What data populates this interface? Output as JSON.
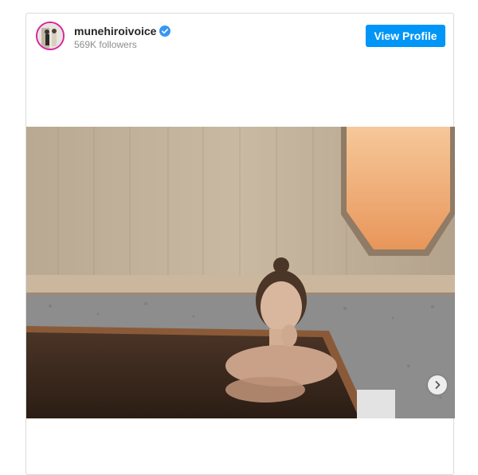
{
  "header": {
    "username": "munehiroivoice",
    "followers": "569K followers",
    "view_profile_label": "View Profile"
  },
  "icons": {
    "verified": "verified-badge-icon",
    "next": "chevron-right-icon"
  },
  "colors": {
    "accent": "#0095f6",
    "verified": "#3897f0"
  }
}
